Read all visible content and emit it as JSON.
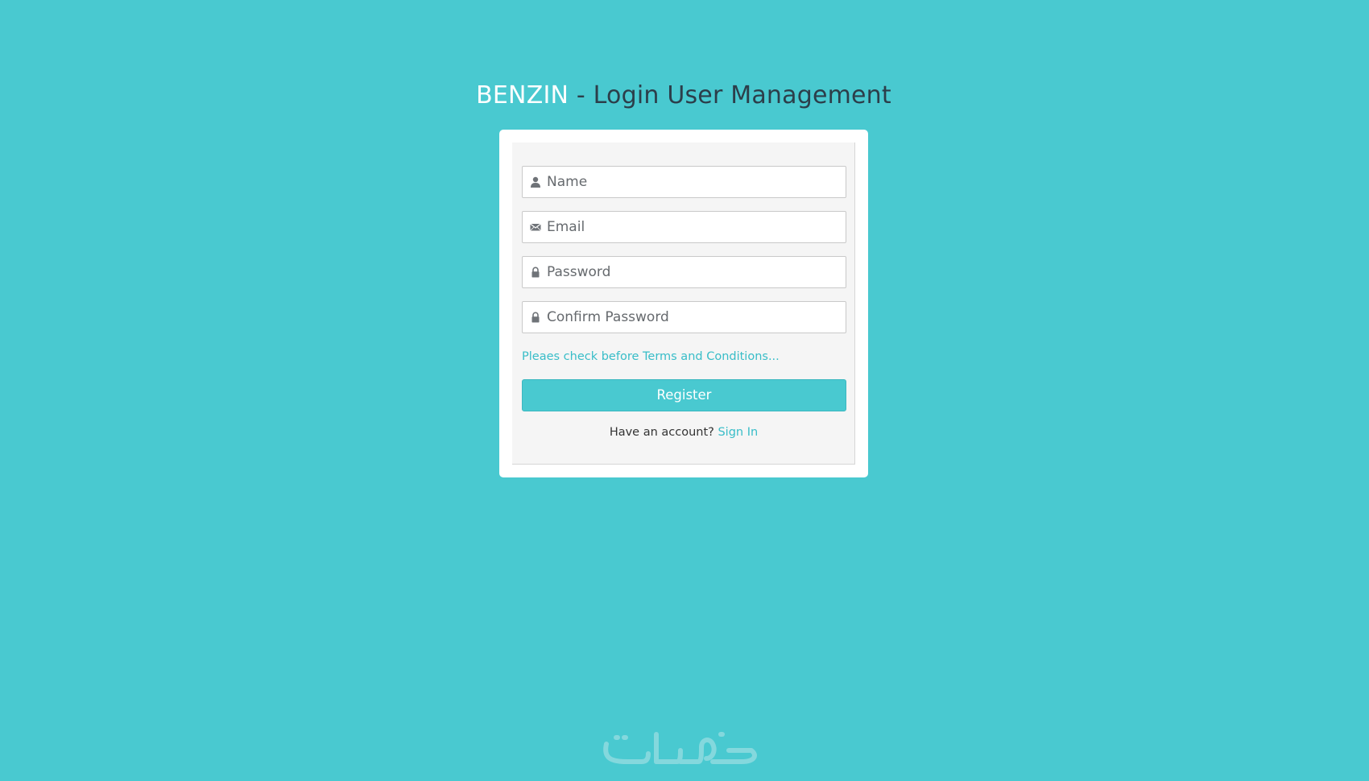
{
  "page": {
    "title_brand": "BENZIN",
    "title_rest": " - Login User Management"
  },
  "form": {
    "name": {
      "placeholder": "Name",
      "value": "",
      "icon": "user-icon"
    },
    "email": {
      "placeholder": "Email",
      "value": "",
      "icon": "envelope-icon"
    },
    "password": {
      "placeholder": "Password",
      "value": "",
      "icon": "lock-icon"
    },
    "confirm_password": {
      "placeholder": "Confirm Password",
      "value": "",
      "icon": "lock-icon"
    },
    "terms_link": "Pleaes check before Terms and Conditions...",
    "register_label": "Register",
    "have_account_text": "Have an account?",
    "sign_in_label": "Sign In"
  },
  "footer": {
    "logo_text": "خمسات"
  },
  "colors": {
    "background": "#49c9d0",
    "accent": "#38bdc8",
    "card": "#ffffff",
    "panel": "#f5f5f5"
  }
}
